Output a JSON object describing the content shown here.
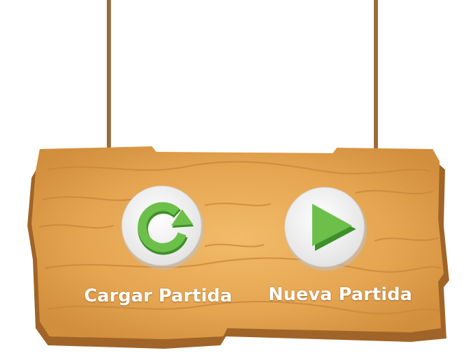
{
  "menu": {
    "load_label": "Cargar Partida",
    "new_label": "Nueva Partida",
    "load_icon": "reload-arrow-icon",
    "new_icon": "play-triangle-icon"
  },
  "colors": {
    "wood_light": "#eeb25f",
    "wood_mid": "#dc9a45",
    "wood_dark": "#a06428",
    "rope": "#9b6b3c",
    "button_face": "#f2f2f2",
    "icon_green": "#6cc04a",
    "icon_green_dark": "#3f8f2a",
    "label_text": "#ffffff"
  }
}
